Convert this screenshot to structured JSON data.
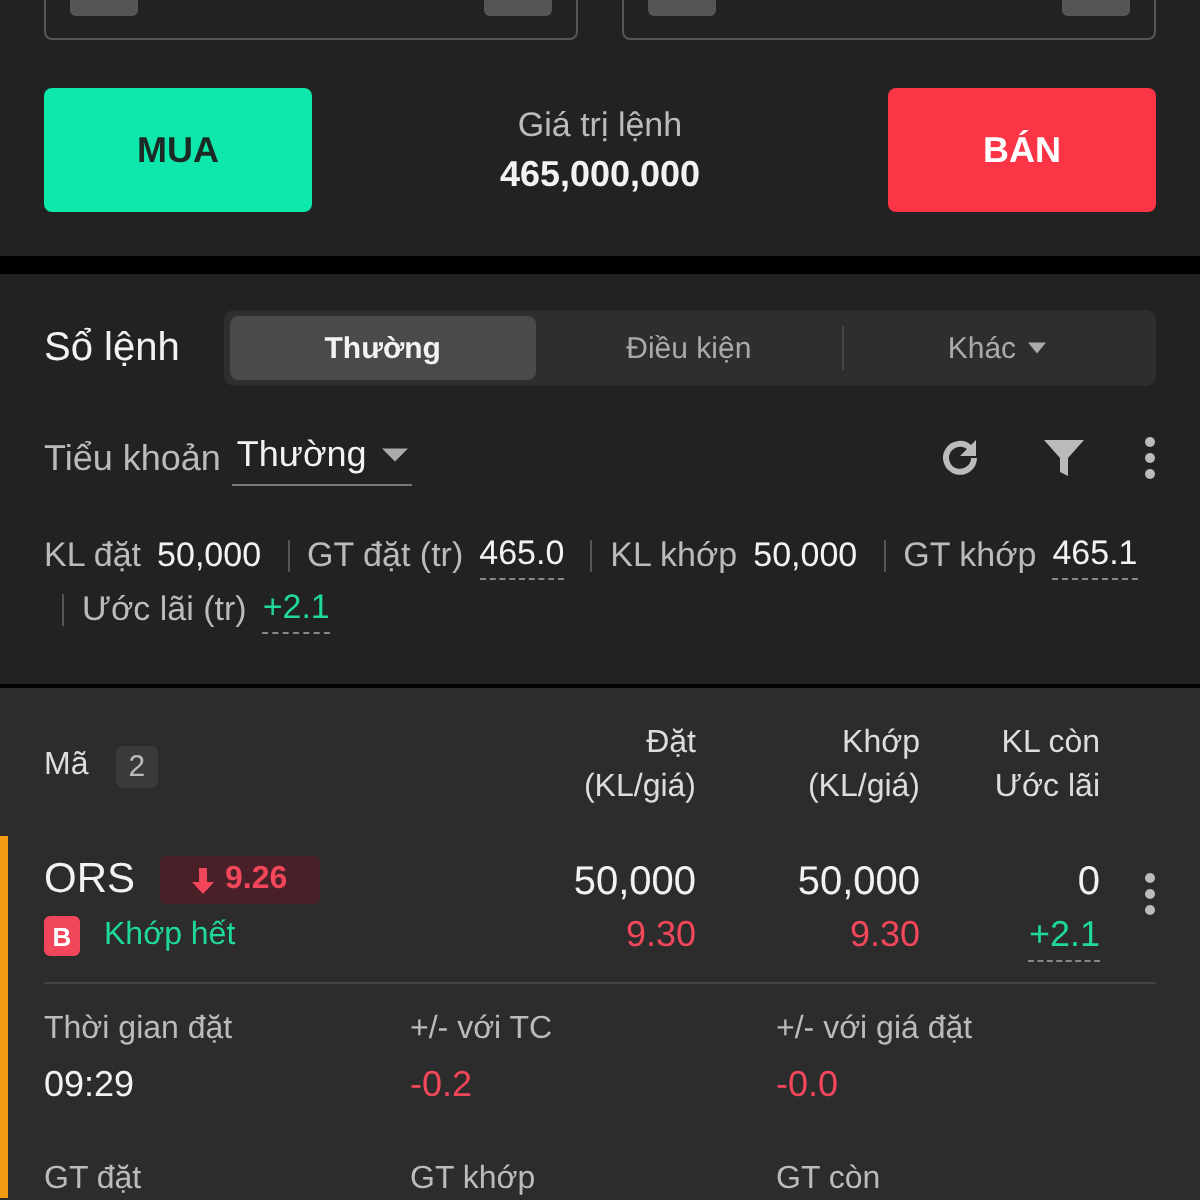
{
  "order_form": {
    "buy_button": "MUA",
    "sell_button": "BÁN",
    "value_label": "Giá trị lệnh",
    "value": "465,000,000"
  },
  "order_book": {
    "title": "Sổ lệnh",
    "tabs": [
      {
        "label": "Thường",
        "selected": true,
        "dropdown": false
      },
      {
        "label": "Điều kiện",
        "selected": false,
        "dropdown": false
      },
      {
        "label": "Khác",
        "selected": false,
        "dropdown": true
      }
    ],
    "subaccount_label": "Tiểu khoản",
    "subaccount_value": "Thường",
    "summary": [
      {
        "label": "KL đặt",
        "value": "50,000",
        "underlined": false,
        "color": "#f2f2f2"
      },
      {
        "label": "GT đặt (tr)",
        "value": "465.0",
        "underlined": true,
        "color": "#f2f2f2"
      },
      {
        "label": "KL khớp",
        "value": "50,000",
        "underlined": false,
        "color": "#f2f2f2"
      },
      {
        "label": "GT khớp",
        "value": "465.1",
        "underlined": true,
        "color": "#f2f2f2"
      },
      {
        "label": "Ước lãi (tr)",
        "value": "+2.1",
        "underlined": true,
        "color": "#1ed997"
      }
    ]
  },
  "table": {
    "symbol_header": "Mã",
    "count": "2",
    "columns": [
      [
        "Đặt",
        "(KL/giá)"
      ],
      [
        "Khớp",
        "(KL/giá)"
      ],
      [
        "KL còn",
        "Ước lãi"
      ]
    ],
    "rows": [
      {
        "symbol": "ORS",
        "change": "9.26",
        "falling": true,
        "highlighted": true,
        "side": "B",
        "status": "Khớp hết",
        "placed_qty": "50,000",
        "placed_price": "9.30",
        "matched_qty": "50,000",
        "matched_price": "9.30",
        "remaining": "0",
        "profit": "+2.1",
        "details": [
          {
            "label": "Thời gian đặt",
            "value": "09:29",
            "color": "#f2f2f2"
          },
          {
            "label": "+/- với TC",
            "value": "-0.2",
            "color": "#f2465a"
          },
          {
            "label": "+/- với giá đặt",
            "value": "-0.0",
            "color": "#f2465a"
          },
          {
            "label": "GT đặt"
          },
          {
            "label": "GT khớp"
          },
          {
            "label": "GT còn"
          }
        ]
      }
    ]
  }
}
